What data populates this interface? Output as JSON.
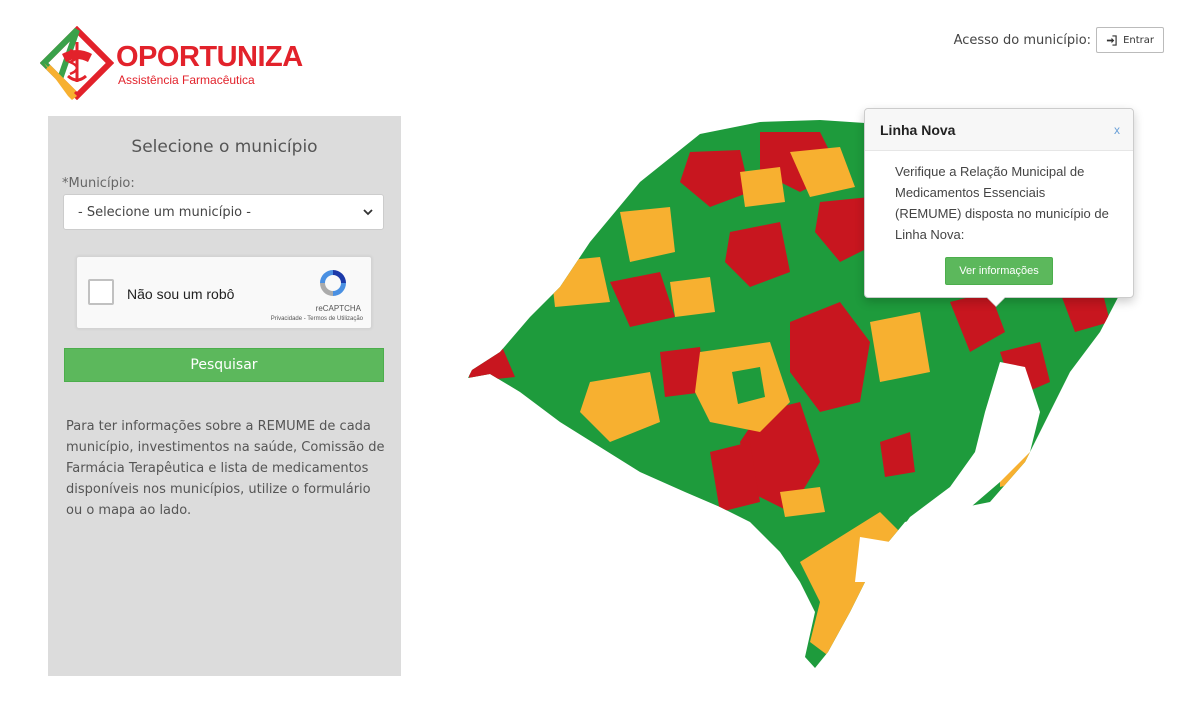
{
  "brand": {
    "name": "OPORTUNIZA",
    "subtitle": "Assistência Farmacêutica"
  },
  "header": {
    "access_label": "Acesso do município:",
    "login_label": "Entrar",
    "login_icon": "sign-in-icon"
  },
  "search_panel": {
    "title": "Selecione o município",
    "municipality_label": "*Município:",
    "municipality_select_value": "- Selecione um município -",
    "captcha": {
      "checkbox_label": "Não sou um robô",
      "brand": "reCAPTCHA",
      "links": "Privacidade - Termos de Utilização"
    },
    "search_button": "Pesquisar",
    "info": "Para ter informações sobre a REMUME de cada município, investimentos na saúde, Comissão de Farmácia Terapêutica e lista de medicamentos disponíveis nos municípios, utilize o formulário ou o mapa ao lado."
  },
  "map": {
    "colors": {
      "green": "#1e9b3c",
      "red": "#c8161f",
      "orange": "#f7b030"
    }
  },
  "popover": {
    "title": "Linha Nova",
    "close_label": "x",
    "body": "Verifique a Relação Municipal de Medicamentos Essenciais (REMUME) disposta no município de Linha Nova:",
    "button_label": "Ver informações"
  }
}
